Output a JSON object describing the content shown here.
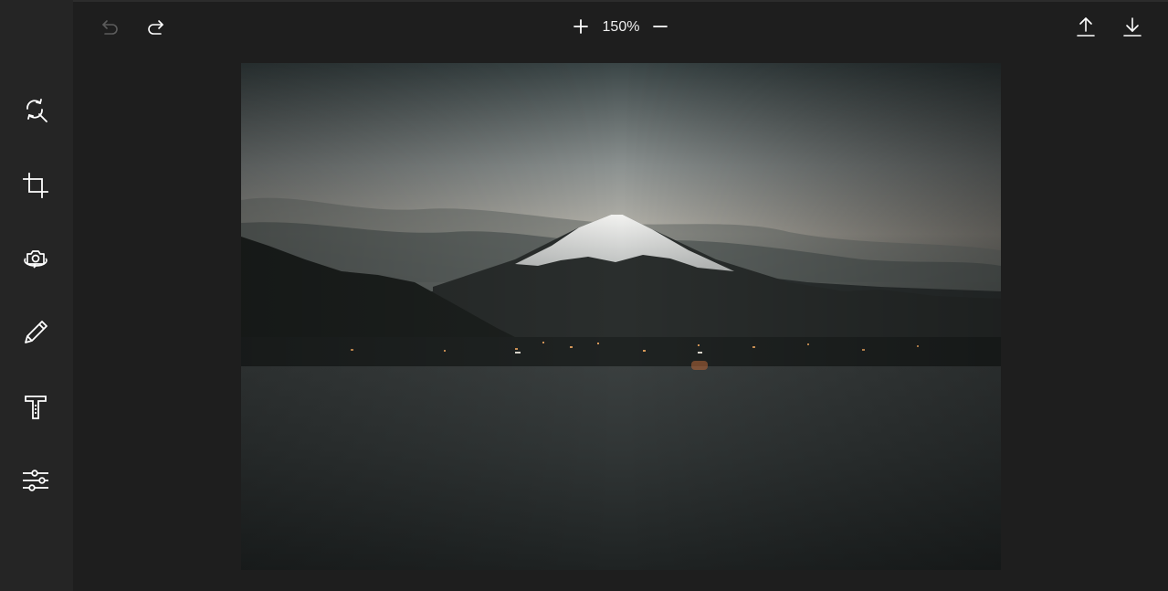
{
  "toolbar": {
    "zoom_level": "150%",
    "undo_icon": "undo-icon",
    "redo_icon": "redo-icon",
    "zoom_in_icon": "plus-icon",
    "zoom_out_icon": "minus-icon",
    "upload_icon": "upload-icon",
    "download_icon": "download-icon"
  },
  "sidebar": {
    "tools": [
      {
        "icon": "magic-search-icon"
      },
      {
        "icon": "crop-icon"
      },
      {
        "icon": "camera-rotate-icon"
      },
      {
        "icon": "pencil-icon"
      },
      {
        "icon": "text-icon"
      },
      {
        "icon": "sliders-icon"
      }
    ]
  },
  "colors": {
    "background": "#1e1e1e",
    "sidebar": "#252525",
    "icon": "#ffffff",
    "icon_disabled": "#5c5c5c"
  }
}
